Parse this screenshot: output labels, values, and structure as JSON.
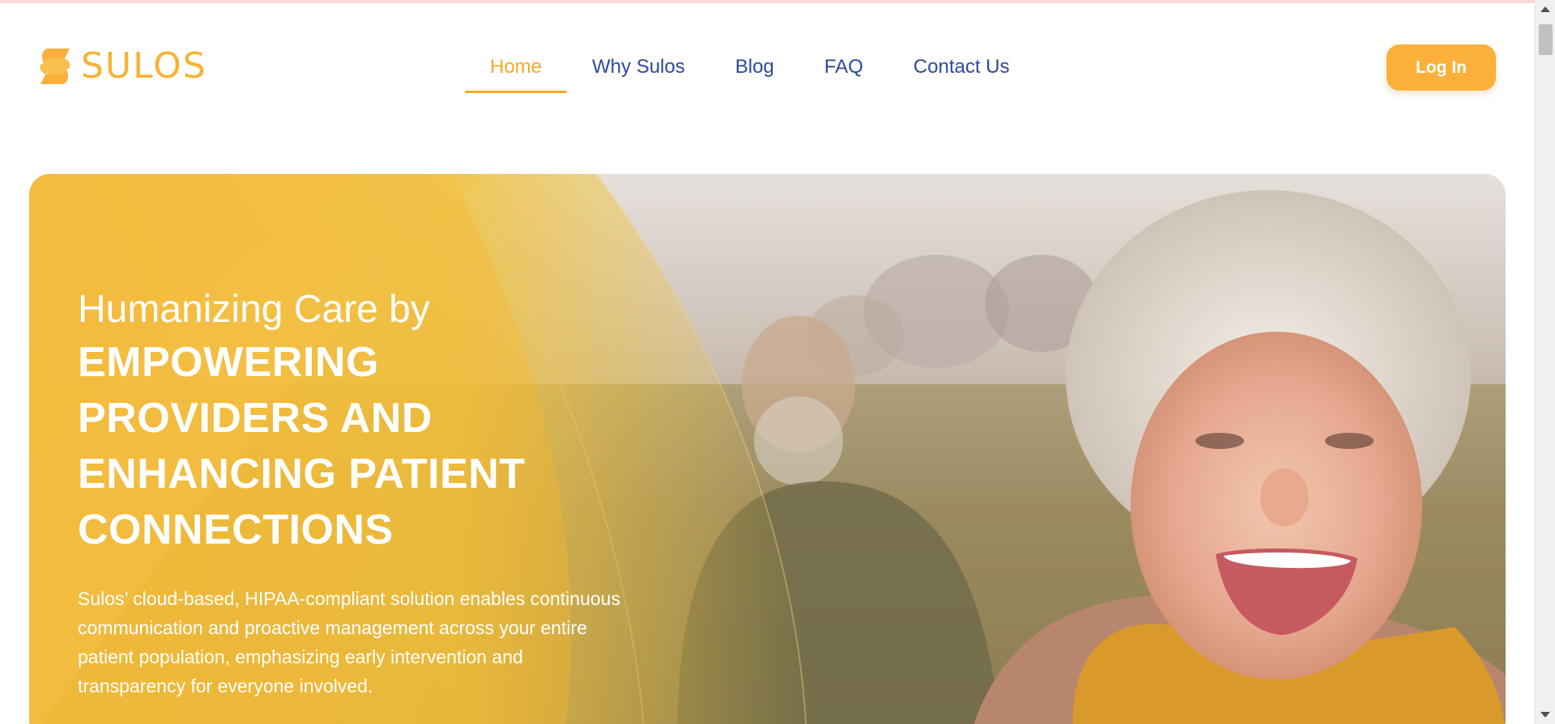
{
  "brand": {
    "name": "SULOS",
    "color": "#f9b233"
  },
  "nav": {
    "items": [
      {
        "label": "Home",
        "active": true
      },
      {
        "label": "Why Sulos",
        "active": false
      },
      {
        "label": "Blog",
        "active": false
      },
      {
        "label": "FAQ",
        "active": false
      },
      {
        "label": "Contact Us",
        "active": false
      }
    ]
  },
  "header": {
    "login_label": "Log In"
  },
  "hero": {
    "lead": "Humanizing Care by",
    "title": "EMPOWERING PROVIDERS AND ENHANCING PATIENT CONNECTIONS",
    "description": "Sulos’ cloud-based, HIPAA-compliant solution enables continuous communication and proactive management across your entire patient population, emphasizing early intervention and transparency for everyone involved."
  },
  "colors": {
    "accent": "#f9a825",
    "nav_text": "#2d4a9a",
    "button": "#fbb03b"
  },
  "icons": [
    "sulos-logo-icon",
    "scroll-up-arrow-icon",
    "scroll-down-arrow-icon"
  ]
}
